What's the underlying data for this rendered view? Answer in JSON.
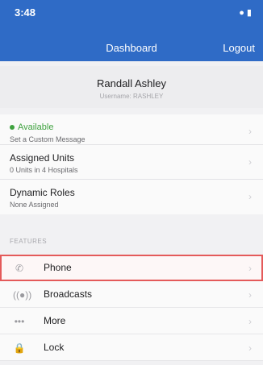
{
  "status_bar": {
    "time": "3:48",
    "icons": "● ▮"
  },
  "nav": {
    "title": "Dashboard",
    "logout_label": "Logout"
  },
  "profile": {
    "name": "Randall Ashley",
    "subtitle": "Username: RASHLEY"
  },
  "status": {
    "title": "Available",
    "subtitle": "Set a Custom Message"
  },
  "assigned_units": {
    "title": "Assigned Units",
    "subtitle": "0 Units in 4 Hospitals"
  },
  "dynamic_roles": {
    "title": "Dynamic Roles",
    "subtitle": "None Assigned"
  },
  "features": {
    "section_label": "FEATURES",
    "items": [
      {
        "label": "Phone",
        "icon": "phone-icon"
      },
      {
        "label": "Broadcasts",
        "icon": "broadcast-icon"
      },
      {
        "label": "More",
        "icon": "more-icon"
      },
      {
        "label": "Lock",
        "icon": "lock-icon"
      }
    ]
  },
  "colors": {
    "header": "#2f6bc6",
    "available": "#3fa23f",
    "selection": "#e45a5a"
  }
}
